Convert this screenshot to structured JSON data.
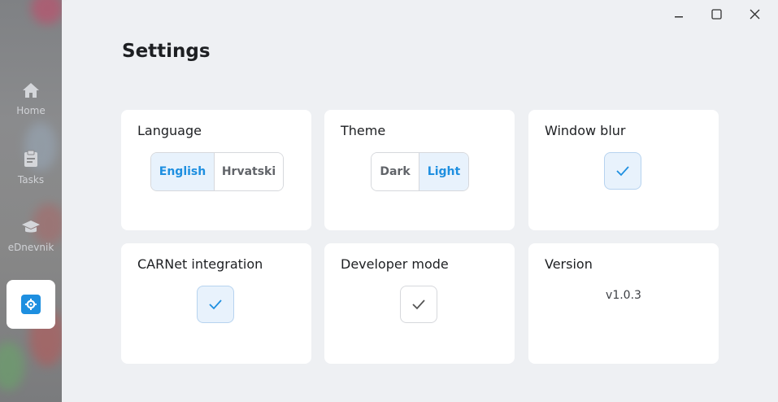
{
  "sidebar": {
    "items": [
      {
        "label": "Home",
        "icon": "home-icon"
      },
      {
        "label": "Tasks",
        "icon": "clipboard-icon"
      },
      {
        "label": "eDnevnik",
        "icon": "graduation-cap-icon"
      },
      {
        "label": "",
        "icon": "gear-icon",
        "active": true
      }
    ]
  },
  "window": {
    "controls": [
      "minimize",
      "maximize",
      "close"
    ]
  },
  "page": {
    "title": "Settings"
  },
  "settings": {
    "language": {
      "title": "Language",
      "options": [
        "English",
        "Hrvatski"
      ],
      "selected": "English"
    },
    "theme": {
      "title": "Theme",
      "options": [
        "Dark",
        "Light"
      ],
      "selected": "Light"
    },
    "window_blur": {
      "title": "Window blur",
      "checked": true
    },
    "carnet": {
      "title": "CARNet integration",
      "checked": true
    },
    "developer_mode": {
      "title": "Developer mode",
      "checked": false
    },
    "version": {
      "title": "Version",
      "value": "v1.0.3"
    }
  },
  "colors": {
    "accent": "#1e8fe0",
    "selected_bg": "#e8f2fc",
    "card_bg": "#ffffff",
    "page_bg": "#eef0f3"
  }
}
